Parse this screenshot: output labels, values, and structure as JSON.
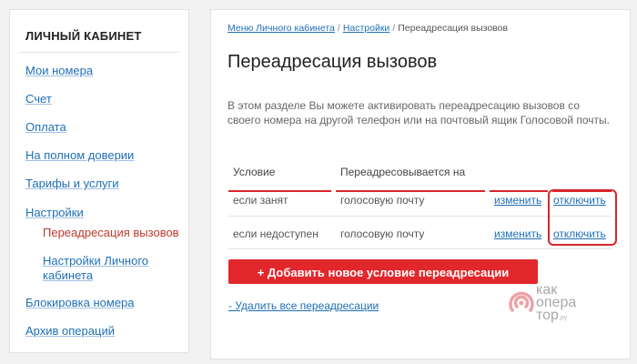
{
  "sidebar": {
    "title": "ЛИЧНЫЙ КАБИНЕТ",
    "items": [
      {
        "label": "Мои номера"
      },
      {
        "label": "Счет"
      },
      {
        "label": "Оплата"
      },
      {
        "label": "На полном доверии"
      },
      {
        "label": "Тарифы и услуги"
      },
      {
        "label": "Настройки"
      },
      {
        "label": "Переадресация вызовов",
        "active": true
      },
      {
        "label": "Настройки Личного кабинета"
      },
      {
        "label": "Блокировка номера"
      },
      {
        "label": "Архив операций"
      }
    ]
  },
  "breadcrumb": {
    "items": [
      "Меню Личного кабинета",
      "Настройки",
      "Переадресация вызовов"
    ],
    "separator": "/"
  },
  "main": {
    "title": "Переадресация вызовов",
    "intro": "В этом разделе Вы можете активировать переадресацию вызовов со своего номера на другой телефон или на почтовый ящик Голосовой почты.",
    "table": {
      "headers": [
        "Условие",
        "Переадресовывается на"
      ],
      "rows": [
        {
          "condition": "если занят",
          "target": "голосовую почту",
          "edit": "изменить",
          "disable": "отключить"
        },
        {
          "condition": "если недоступен",
          "target": "голосовую почту",
          "edit": "изменить",
          "disable": "отключить"
        }
      ]
    },
    "add_button": "+ Добавить новое условие переадресации",
    "delete_all": "- Удалить все переадресации"
  },
  "watermark": {
    "line1": "как",
    "line2": "опера",
    "line3": "тор",
    "suffix": ".ру"
  },
  "colors": {
    "accent": "#e2272c",
    "link": "#1f6fb5",
    "active": "#c0392b"
  }
}
